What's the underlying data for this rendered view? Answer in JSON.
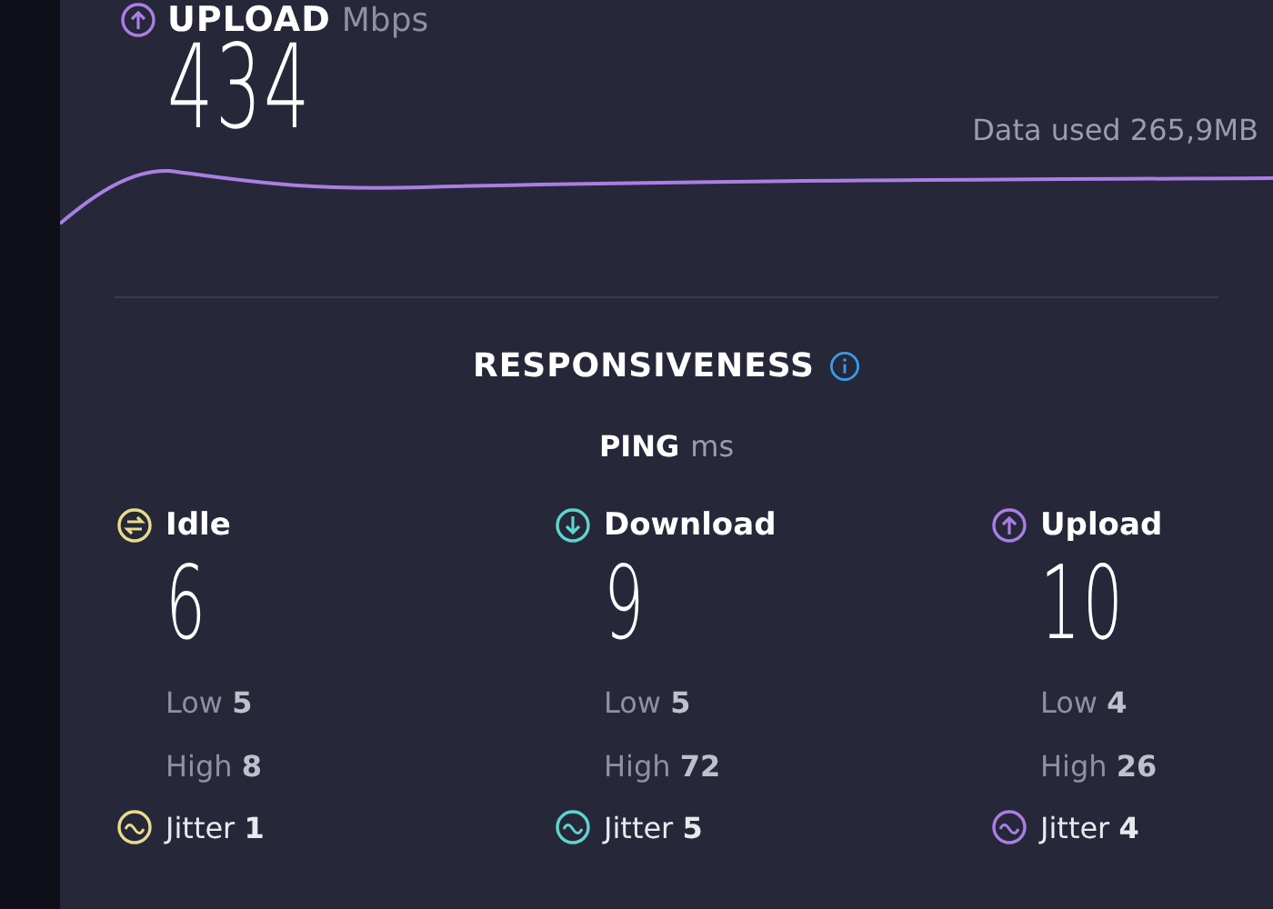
{
  "upload": {
    "title": "UPLOAD",
    "unit": "Mbps",
    "value": "434",
    "data_used": "Data used 265,9MB"
  },
  "responsiveness": {
    "title": "RESPONSIVENESS",
    "ping_label": "PING",
    "ping_unit": "ms",
    "columns": [
      {
        "kind": "idle",
        "color": "#e6dc8c",
        "label": "Idle",
        "value": "6",
        "low": "Low **5**",
        "high": "High **8**",
        "jitter": "Jitter **1**"
      },
      {
        "kind": "download",
        "color": "#5fd3cd",
        "label": "Download",
        "value": "9",
        "low": "Low **5**",
        "high": "High **72**",
        "jitter": "Jitter **5**"
      },
      {
        "kind": "upload",
        "color": "#a97fe3",
        "label": "Upload",
        "value": "10",
        "low": "Low **4**",
        "high": "High **26**",
        "jitter": "Jitter **4**"
      }
    ]
  }
}
